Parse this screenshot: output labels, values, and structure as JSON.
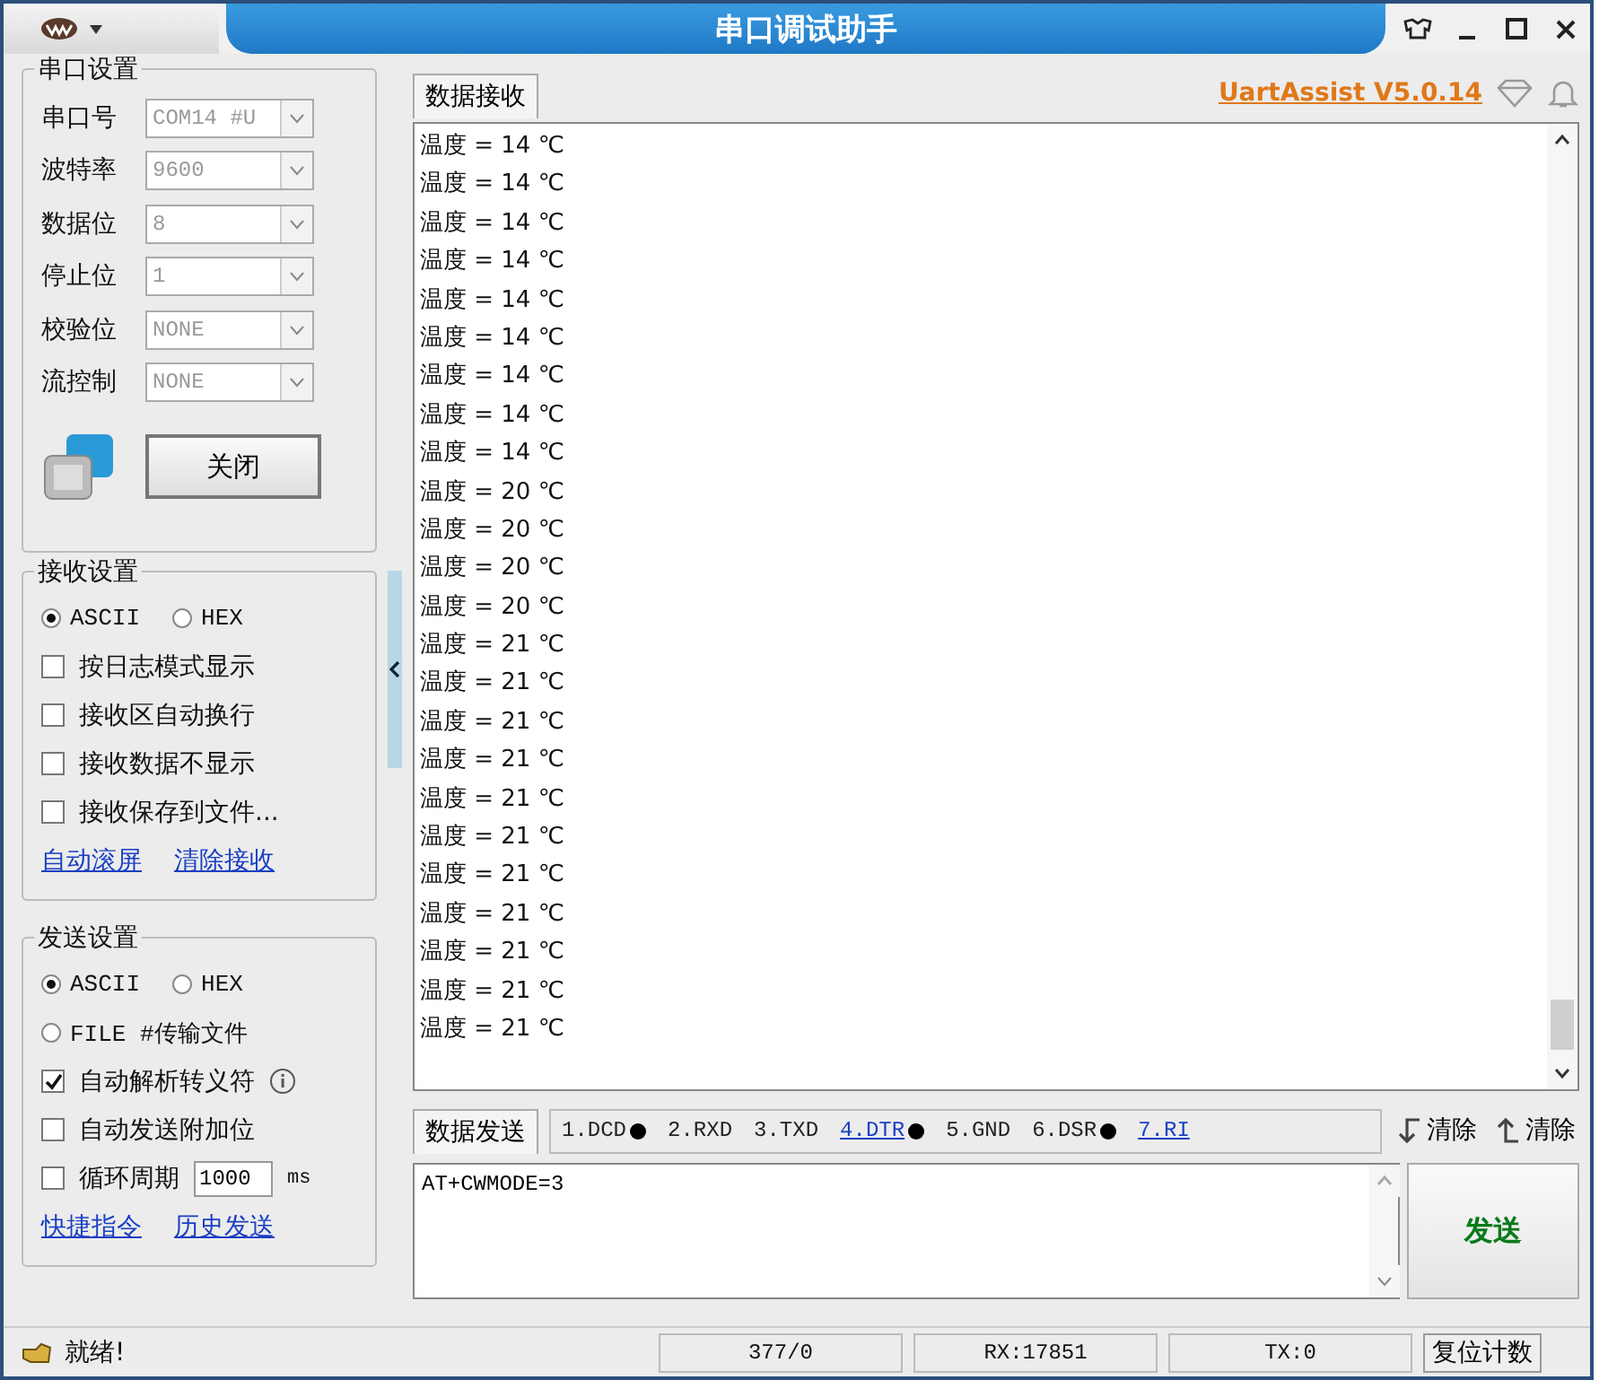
{
  "window": {
    "title": "串口调试助手"
  },
  "serial_settings": {
    "title": "串口设置",
    "fields": [
      {
        "label": "串口号",
        "value": "COM14 #U",
        "disabled": true
      },
      {
        "label": "波特率",
        "value": "9600",
        "disabled": true
      },
      {
        "label": "数据位",
        "value": "8",
        "disabled": true
      },
      {
        "label": "停止位",
        "value": "1",
        "disabled": true
      },
      {
        "label": "校验位",
        "value": "NONE",
        "disabled": true
      },
      {
        "label": "流控制",
        "value": "NONE",
        "disabled": true
      }
    ],
    "open_button": "关闭"
  },
  "receive_settings": {
    "title": "接收设置",
    "modes": [
      {
        "label": "ASCII",
        "selected": true
      },
      {
        "label": "HEX",
        "selected": false
      }
    ],
    "options": [
      {
        "label": "按日志模式显示",
        "checked": false
      },
      {
        "label": "接收区自动换行",
        "checked": false
      },
      {
        "label": "接收数据不显示",
        "checked": false
      },
      {
        "label": "接收保存到文件...",
        "checked": false
      }
    ],
    "links": [
      "自动滚屏",
      "清除接收"
    ]
  },
  "send_settings": {
    "title": "发送设置",
    "modes": [
      {
        "label": "ASCII",
        "selected": true
      },
      {
        "label": "HEX",
        "selected": false
      },
      {
        "label": "FILE #传输文件",
        "selected": false
      }
    ],
    "options": [
      {
        "kind": "info",
        "label": "自动解析转义符",
        "checked": true
      },
      {
        "kind": "plain",
        "label": "自动发送附加位",
        "checked": false
      },
      {
        "kind": "period",
        "label": "循环周期",
        "checked": false,
        "value": "1000",
        "unit": "ms"
      }
    ],
    "links": [
      "快捷指令",
      "历史发送"
    ]
  },
  "receive": {
    "tab": "数据接收",
    "version_link": "UartAssist V5.0.14",
    "lines": [
      "温度 = 14 ℃",
      "温度 = 14 ℃",
      "温度 = 14 ℃",
      "温度 = 14 ℃",
      "温度 = 14 ℃",
      "温度 = 14 ℃",
      "温度 = 14 ℃",
      "温度 = 14 ℃",
      "温度 = 14 ℃",
      "温度 = 20 ℃",
      "温度 = 20 ℃",
      "温度 = 20 ℃",
      "温度 = 20 ℃",
      "温度 = 21 ℃",
      "温度 = 21 ℃",
      "温度 = 21 ℃",
      "温度 = 21 ℃",
      "温度 = 21 ℃",
      "温度 = 21 ℃",
      "温度 = 21 ℃",
      "温度 = 21 ℃",
      "温度 = 21 ℃",
      "温度 = 21 ℃",
      "温度 = 21 ℃"
    ]
  },
  "send": {
    "tab": "数据发送",
    "pins": [
      {
        "label": "1.DCD",
        "dot": true,
        "link": false
      },
      {
        "label": "2.RXD",
        "dot": false,
        "link": false
      },
      {
        "label": "3.TXD",
        "dot": false,
        "link": false
      },
      {
        "label": "4.DTR",
        "dot": true,
        "link": true
      },
      {
        "label": "5.GND",
        "dot": false,
        "link": false
      },
      {
        "label": "6.DSR",
        "dot": true,
        "link": false
      },
      {
        "label": "7.RI",
        "dot": false,
        "link": true
      }
    ],
    "clear_buttons": [
      {
        "kind": "down",
        "label": "清除"
      },
      {
        "kind": "up",
        "label": "清除"
      }
    ],
    "input": "AT+CWMODE=3",
    "send_button": "发送"
  },
  "status_bar": {
    "status": "就绪!",
    "fields": [
      "377/0",
      "RX:17851",
      "TX:0"
    ],
    "reset_button": "复位计数"
  }
}
